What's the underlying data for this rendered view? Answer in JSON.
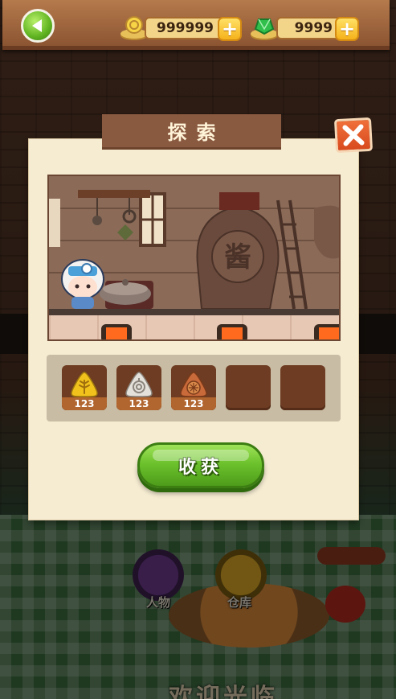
{
  "hud": {
    "coins": "999999",
    "gems": "9999",
    "plus_label": "+"
  },
  "dialog": {
    "title": "探索",
    "close_label": "✕",
    "scene_sign": "酱",
    "items": [
      {
        "icon": "wheat-gem-icon",
        "count": "123",
        "color": "#f2c21c"
      },
      {
        "icon": "shell-gem-icon",
        "count": "123",
        "color": "#e4e0da"
      },
      {
        "icon": "cookie-gem-icon",
        "count": "123",
        "color": "#c96a3a"
      },
      {
        "icon": "empty-slot",
        "count": ""
      },
      {
        "icon": "empty-slot",
        "count": ""
      }
    ],
    "collect_label": "收获"
  },
  "background": {
    "person_label": "人物",
    "store_label": "仓库",
    "welcome_text": "欢迎光临"
  }
}
